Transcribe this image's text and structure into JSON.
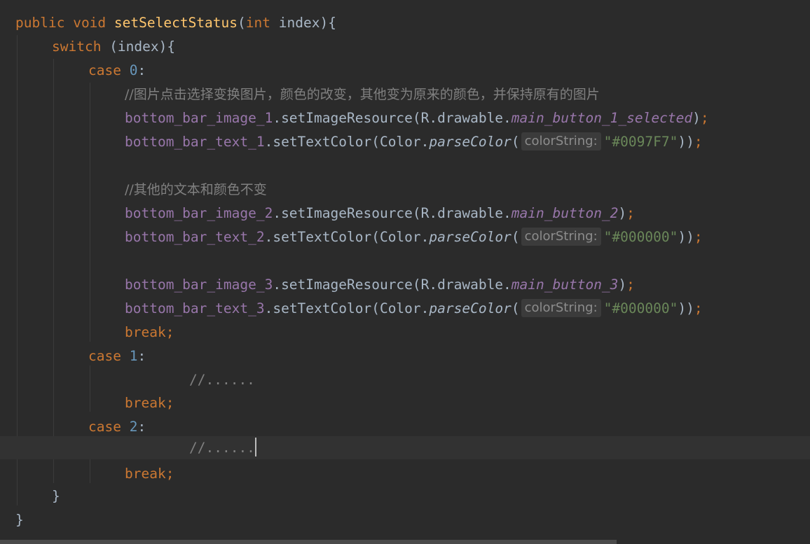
{
  "code": {
    "l1": {
      "kw1": "public",
      "kw2": "void",
      "method": "setSelectStatus",
      "open": "(",
      "kw3": "int",
      "rest": " index){"
    },
    "l2": {
      "kw": "switch",
      "rest": " (index){"
    },
    "l3": {
      "kw": "case",
      "num": "0",
      "colon": ":"
    },
    "l4": {
      "comment": "//图片点击选择变换图片，颜色的改变，其他变为原来的颜色，并保持原有的图片"
    },
    "l5": {
      "field": "bottom_bar_image_1",
      "call": ".setImageResource(R.drawable.",
      "res": "main_button_1_selected",
      "close": ")",
      "semi": ";"
    },
    "l6": {
      "field": "bottom_bar_text_1",
      "call": ".setTextColor(Color.",
      "sm": "parseColor",
      "open": "(",
      "hint": "colorString:",
      "str": "\"#0097F7\"",
      "close": "))",
      "semi": ";"
    },
    "l8": {
      "comment": "//其他的文本和颜色不变"
    },
    "l9": {
      "field": "bottom_bar_image_2",
      "call": ".setImageResource(R.drawable.",
      "res": "main_button_2",
      "close": ")",
      "semi": ";"
    },
    "l10": {
      "field": "bottom_bar_text_2",
      "call": ".setTextColor(Color.",
      "sm": "parseColor",
      "open": "(",
      "hint": "colorString:",
      "str": "\"#000000\"",
      "close": "))",
      "semi": ";"
    },
    "l12": {
      "field": "bottom_bar_image_3",
      "call": ".setImageResource(R.drawable.",
      "res": "main_button_3",
      "close": ")",
      "semi": ";"
    },
    "l13": {
      "field": "bottom_bar_text_3",
      "call": ".setTextColor(Color.",
      "sm": "parseColor",
      "open": "(",
      "hint": "colorString:",
      "str": "\"#000000\"",
      "close": "))",
      "semi": ";"
    },
    "l14": {
      "kw": "break",
      "semi": ";"
    },
    "l15": {
      "kw": "case",
      "num": "1",
      "colon": ":"
    },
    "l16": {
      "comment": "//......"
    },
    "l17": {
      "kw": "break",
      "semi": ";"
    },
    "l18": {
      "kw": "case",
      "num": "2",
      "colon": ":"
    },
    "l19": {
      "comment": "//......"
    },
    "l20": {
      "kw": "break",
      "semi": ";"
    },
    "l21": {
      "brace": "}"
    },
    "l22": {
      "brace": "}"
    }
  },
  "colors": {
    "background": "#2b2b2b",
    "keyword": "#cc7832",
    "method": "#ffc66d",
    "number": "#6897bb",
    "string": "#6a8759",
    "field": "#9876aa",
    "comment": "#808080",
    "text": "#a9b7c6"
  }
}
